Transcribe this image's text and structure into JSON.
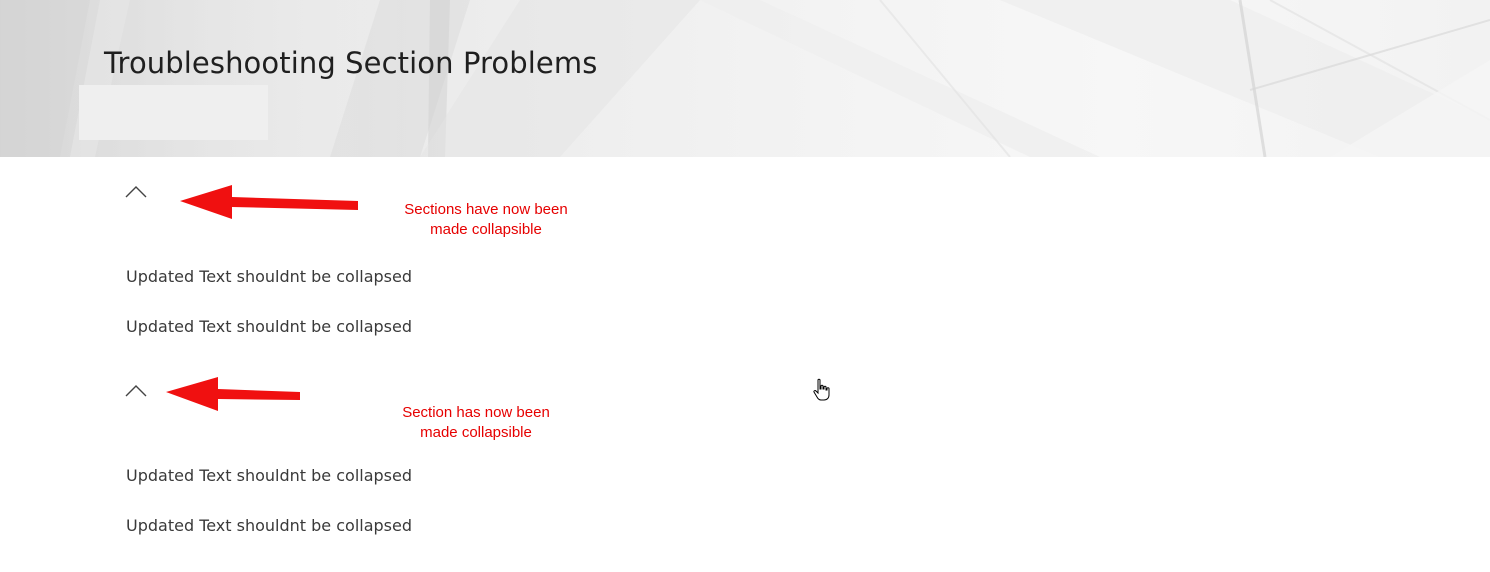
{
  "header": {
    "title": "Troubleshooting Section Problems"
  },
  "sections": [
    {
      "annotation_line1": "Sections have now been",
      "annotation_line2": "made collapsible",
      "items": [
        "Updated Text shouldnt be collapsed",
        "Updated Text shouldnt be collapsed"
      ]
    },
    {
      "annotation_line1": "Section has now been",
      "annotation_line2": "made collapsible",
      "items": [
        "Updated Text shouldnt be collapsed",
        "Updated Text shouldnt be collapsed"
      ]
    }
  ],
  "colors": {
    "annotation": "#e60000",
    "title": "#1f1f1f",
    "body_text": "#3a3a3a"
  },
  "icons": {
    "collapse": "chevron-up-icon",
    "annotation_arrow": "arrow-left-icon",
    "cursor": "hand-pointer-icon"
  }
}
